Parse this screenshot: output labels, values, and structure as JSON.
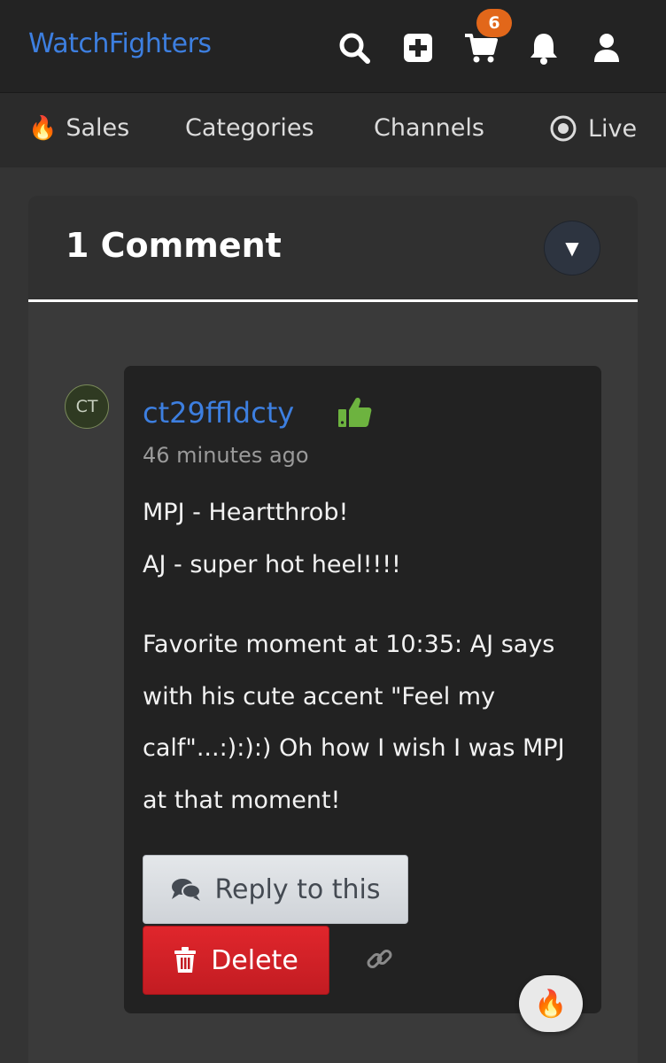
{
  "header": {
    "brand": "WatchFighters",
    "cart_count": "6",
    "icons": [
      "search-icon",
      "add-icon",
      "cart-icon",
      "bell-icon",
      "user-icon"
    ]
  },
  "nav": {
    "items": [
      {
        "label": "Sales",
        "icon": "fire-icon"
      },
      {
        "label": "Categories"
      },
      {
        "label": "Channels"
      },
      {
        "label": "Live",
        "icon": "live-icon"
      }
    ]
  },
  "comments": {
    "title": "1 Comment",
    "toggle_symbol": "▼",
    "items": [
      {
        "avatar_initials": "CT",
        "username": "ct29ffldcty",
        "time": "46 minutes ago",
        "lines": [
          "MPJ - Heartthrob!",
          "AJ - super hot heel!!!!",
          "Favorite moment at 10:35: AJ says",
          "with his cute accent \"Feel my",
          "calf\"...:):):) Oh how I wish I was MPJ",
          "at that moment!"
        ],
        "reply_label": "Reply to this",
        "delete_label": "Delete",
        "reaction_emoji": "🔥"
      }
    ]
  },
  "colors": {
    "brand": "#3d7fe0",
    "badge": "#e2671a",
    "delete": "#d22127",
    "like": "#6db33f"
  }
}
